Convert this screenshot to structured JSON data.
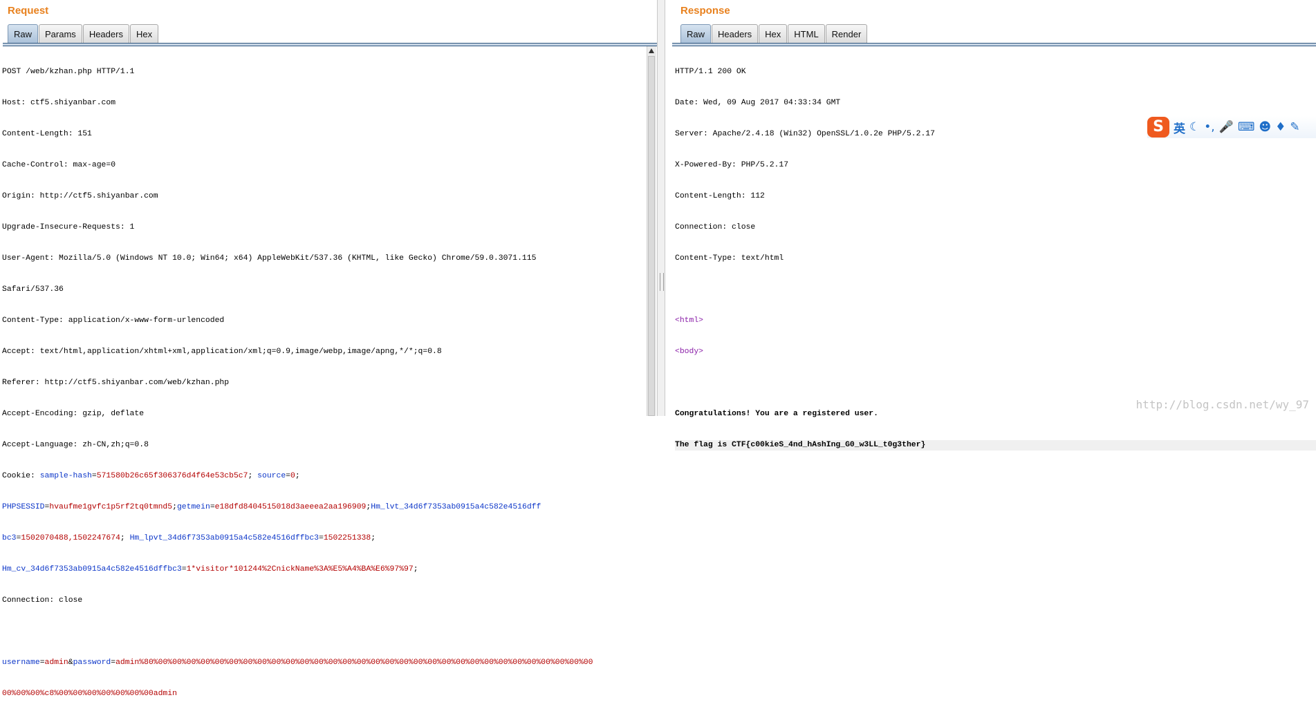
{
  "request": {
    "title": "Request",
    "tabs": [
      "Raw",
      "Params",
      "Headers",
      "Hex"
    ],
    "active_tab": "Raw",
    "lines": [
      "POST /web/kzhan.php HTTP/1.1",
      "Host: ctf5.shiyanbar.com",
      "Content-Length: 151",
      "Cache-Control: max-age=0",
      "Origin: http://ctf5.shiyanbar.com",
      "Upgrade-Insecure-Requests: 1",
      "User-Agent: Mozilla/5.0 (Windows NT 10.0; Win64; x64) AppleWebKit/537.36 (KHTML, like Gecko) Chrome/59.0.3071.115",
      "Safari/537.36",
      "Content-Type: application/x-www-form-urlencoded",
      "Accept: text/html,application/xhtml+xml,application/xml;q=0.9,image/webp,image/apng,*/*;q=0.8",
      "Referer: http://ctf5.shiyanbar.com/web/kzhan.php",
      "Accept-Encoding: gzip, deflate",
      "Accept-Language: zh-CN,zh;q=0.8"
    ],
    "cookie": {
      "label": "Cookie: ",
      "line1": [
        {
          "k": "sample-hash",
          "v": "571580b26c65f306376d4f64e53cb5c7"
        },
        {
          "k": "source",
          "v": "0"
        }
      ],
      "line2": [
        {
          "k": "PHPSESSID",
          "v": "hvaufme1gvfc1p5rf2tq0tmnd5"
        },
        {
          "k": "getmein",
          "v": "e18dfd8404515018d3aeeea2aa196909"
        },
        {
          "k": "Hm_lvt_34d6f7353ab0915a4c582e4516dff",
          "v": ""
        }
      ],
      "line3_prefix_key": "bc3",
      "line3_value": "1502070488,1502247674",
      "line3_key2": "Hm_lpvt_34d6f7353ab0915a4c582e4516dffbc3",
      "line3_value2": "1502251338",
      "line4_key": "Hm_cv_34d6f7353ab0915a4c582e4516dffbc3",
      "line4_value": "1*visitor*101244%2CnickName%3A%E5%A4%BA%E6%97%97"
    },
    "connection": "Connection: close",
    "body": {
      "k1": "username",
      "v1": "admin",
      "k2": "password",
      "v2_line1": "admin%80%00%00%00%00%00%00%00%00%00%00%00%00%00%00%00%00%00%00%00%00%00%00%00%00%00%00%00%00%00%00%00",
      "v2_line2": "00%00%00%c8%00%00%00%00%00%00%00admin"
    }
  },
  "response": {
    "title": "Response",
    "tabs": [
      "Raw",
      "Headers",
      "Hex",
      "HTML",
      "Render"
    ],
    "active_tab": "Raw",
    "headers": [
      "HTTP/1.1 200 OK",
      "Date: Wed, 09 Aug 2017 04:33:34 GMT",
      "Server: Apache/2.4.18 (Win32) OpenSSL/1.0.2e PHP/5.2.17",
      "X-Powered-By: PHP/5.2.17",
      "Content-Length: 112",
      "Connection: close",
      "Content-Type: text/html"
    ],
    "html_open": "<html>",
    "body_open": "<body>",
    "message": "Congratulations! You are a registered user.",
    "flag": "The flag is CTF{c00kieS_4nd_hAshIng_G0_w3LL_t0g3ther}"
  },
  "ime": {
    "logo": "S",
    "lang": "英",
    "icons": [
      "moon-icon",
      "punctuation-icon",
      "microphone-icon",
      "keyboard-icon",
      "user-icon",
      "shirt-icon",
      "wrench-icon"
    ]
  },
  "watermark": "http://blog.csdn.net/wy_97"
}
